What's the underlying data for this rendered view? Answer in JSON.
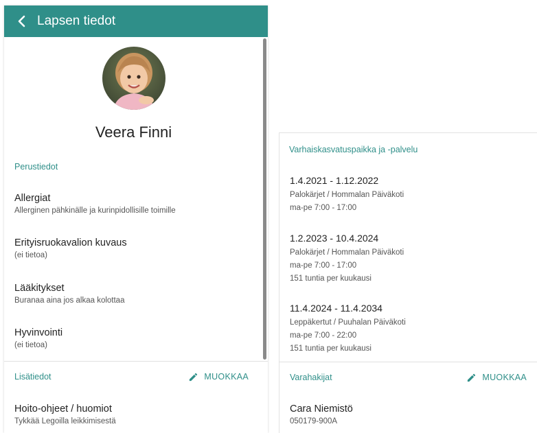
{
  "header": {
    "title": "Lapsen tiedot"
  },
  "child": {
    "name": "Veera Finni"
  },
  "basic_info": {
    "label": "Perustiedot",
    "fields": [
      {
        "title": "Allergiat",
        "value": "Allerginen pähkinälle ja kurinpidollisille toimille"
      },
      {
        "title": "Erityisruokavalion kuvaus",
        "value": "(ei tietoa)"
      },
      {
        "title": "Lääkitykset",
        "value": "Buranaa aina jos alkaa kolottaa"
      },
      {
        "title": "Hyvinvointi",
        "value": "(ei tietoa)"
      }
    ]
  },
  "extra_info": {
    "label": "Lisätiedot",
    "edit_label": "MUOKKAA",
    "fields": [
      {
        "title": "Hoito-ohjeet / huomiot",
        "value": "Tykkää Legoilla leikkimisestä"
      }
    ]
  },
  "placements": {
    "label": "Varhaiskasvatuspaikka ja -palvelu",
    "items": [
      {
        "dates": "1.4.2021 - 1.12.2022",
        "unit": "Palokärjet / Hommalan Päiväkoti",
        "hours": "ma-pe 7:00 - 17:00",
        "extra": ""
      },
      {
        "dates": "1.2.2023 - 10.4.2024",
        "unit": "Palokärjet / Hommalan Päiväkoti",
        "hours": "ma-pe 7:00 - 17:00",
        "extra": "151 tuntia per kuukausi"
      },
      {
        "dates": "11.4.2024 - 11.4.2034",
        "unit": "Leppäkertut / Puuhalan Päiväkoti",
        "hours": "ma-pe 7:00 - 22:00",
        "extra": "151 tuntia per kuukausi"
      }
    ]
  },
  "backup_guardians": {
    "label": "Varahakijat",
    "edit_label": "MUOKKAA",
    "people": [
      {
        "name": "Cara Niemistö",
        "id": "050179-900A"
      }
    ]
  },
  "colors": {
    "accent": "#2f8f89",
    "header_bg": "#2f8f89"
  },
  "icons": [
    "chevron-left-icon",
    "pencil-icon"
  ]
}
